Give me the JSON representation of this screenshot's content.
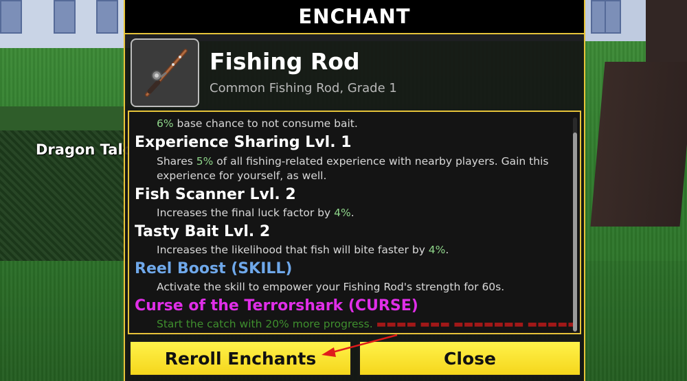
{
  "scene": {
    "npc_label": "Dragon Talo"
  },
  "panel": {
    "title": "ENCHANT",
    "item": {
      "name": "Fishing Rod",
      "subtitle": "Common Fishing Rod, Grade 1",
      "icon": "fishing-rod-icon"
    },
    "enchants": [
      {
        "desc_pct": "6%",
        "desc_rest": " base chance to not consume bait."
      },
      {
        "title": "Experience Sharing Lvl. 1",
        "desc_pre": "Shares ",
        "desc_pct": "5%",
        "desc_post": " of all fishing-related experience with nearby players. Gain this experience for yourself, as well."
      },
      {
        "title": "Fish Scanner Lvl. 2",
        "desc_pre": "Increases the final luck factor by ",
        "desc_pct": "4%",
        "desc_post": "."
      },
      {
        "title": "Tasty Bait Lvl. 2",
        "desc_pre": "Increases the likelihood that fish will bite faster by ",
        "desc_pct": "4%",
        "desc_post": "."
      },
      {
        "title": "Reel Boost (SKILL)",
        "desc": "Activate the skill to empower your Fishing Rod's strength for 60s."
      },
      {
        "title": "Curse of the Terrorshark (CURSE)",
        "desc": "Start the catch with 20% more progress."
      }
    ],
    "buttons": {
      "reroll": "Reroll Enchants",
      "close": "Close"
    }
  },
  "colors": {
    "accent_border": "#e7c43a",
    "button_yellow": "#f5d61c",
    "skill_blue": "#6fa8ea",
    "curse_magenta": "#e02ee8",
    "percent_green": "#8fd68a",
    "annotation_red": "#e01b1b"
  }
}
